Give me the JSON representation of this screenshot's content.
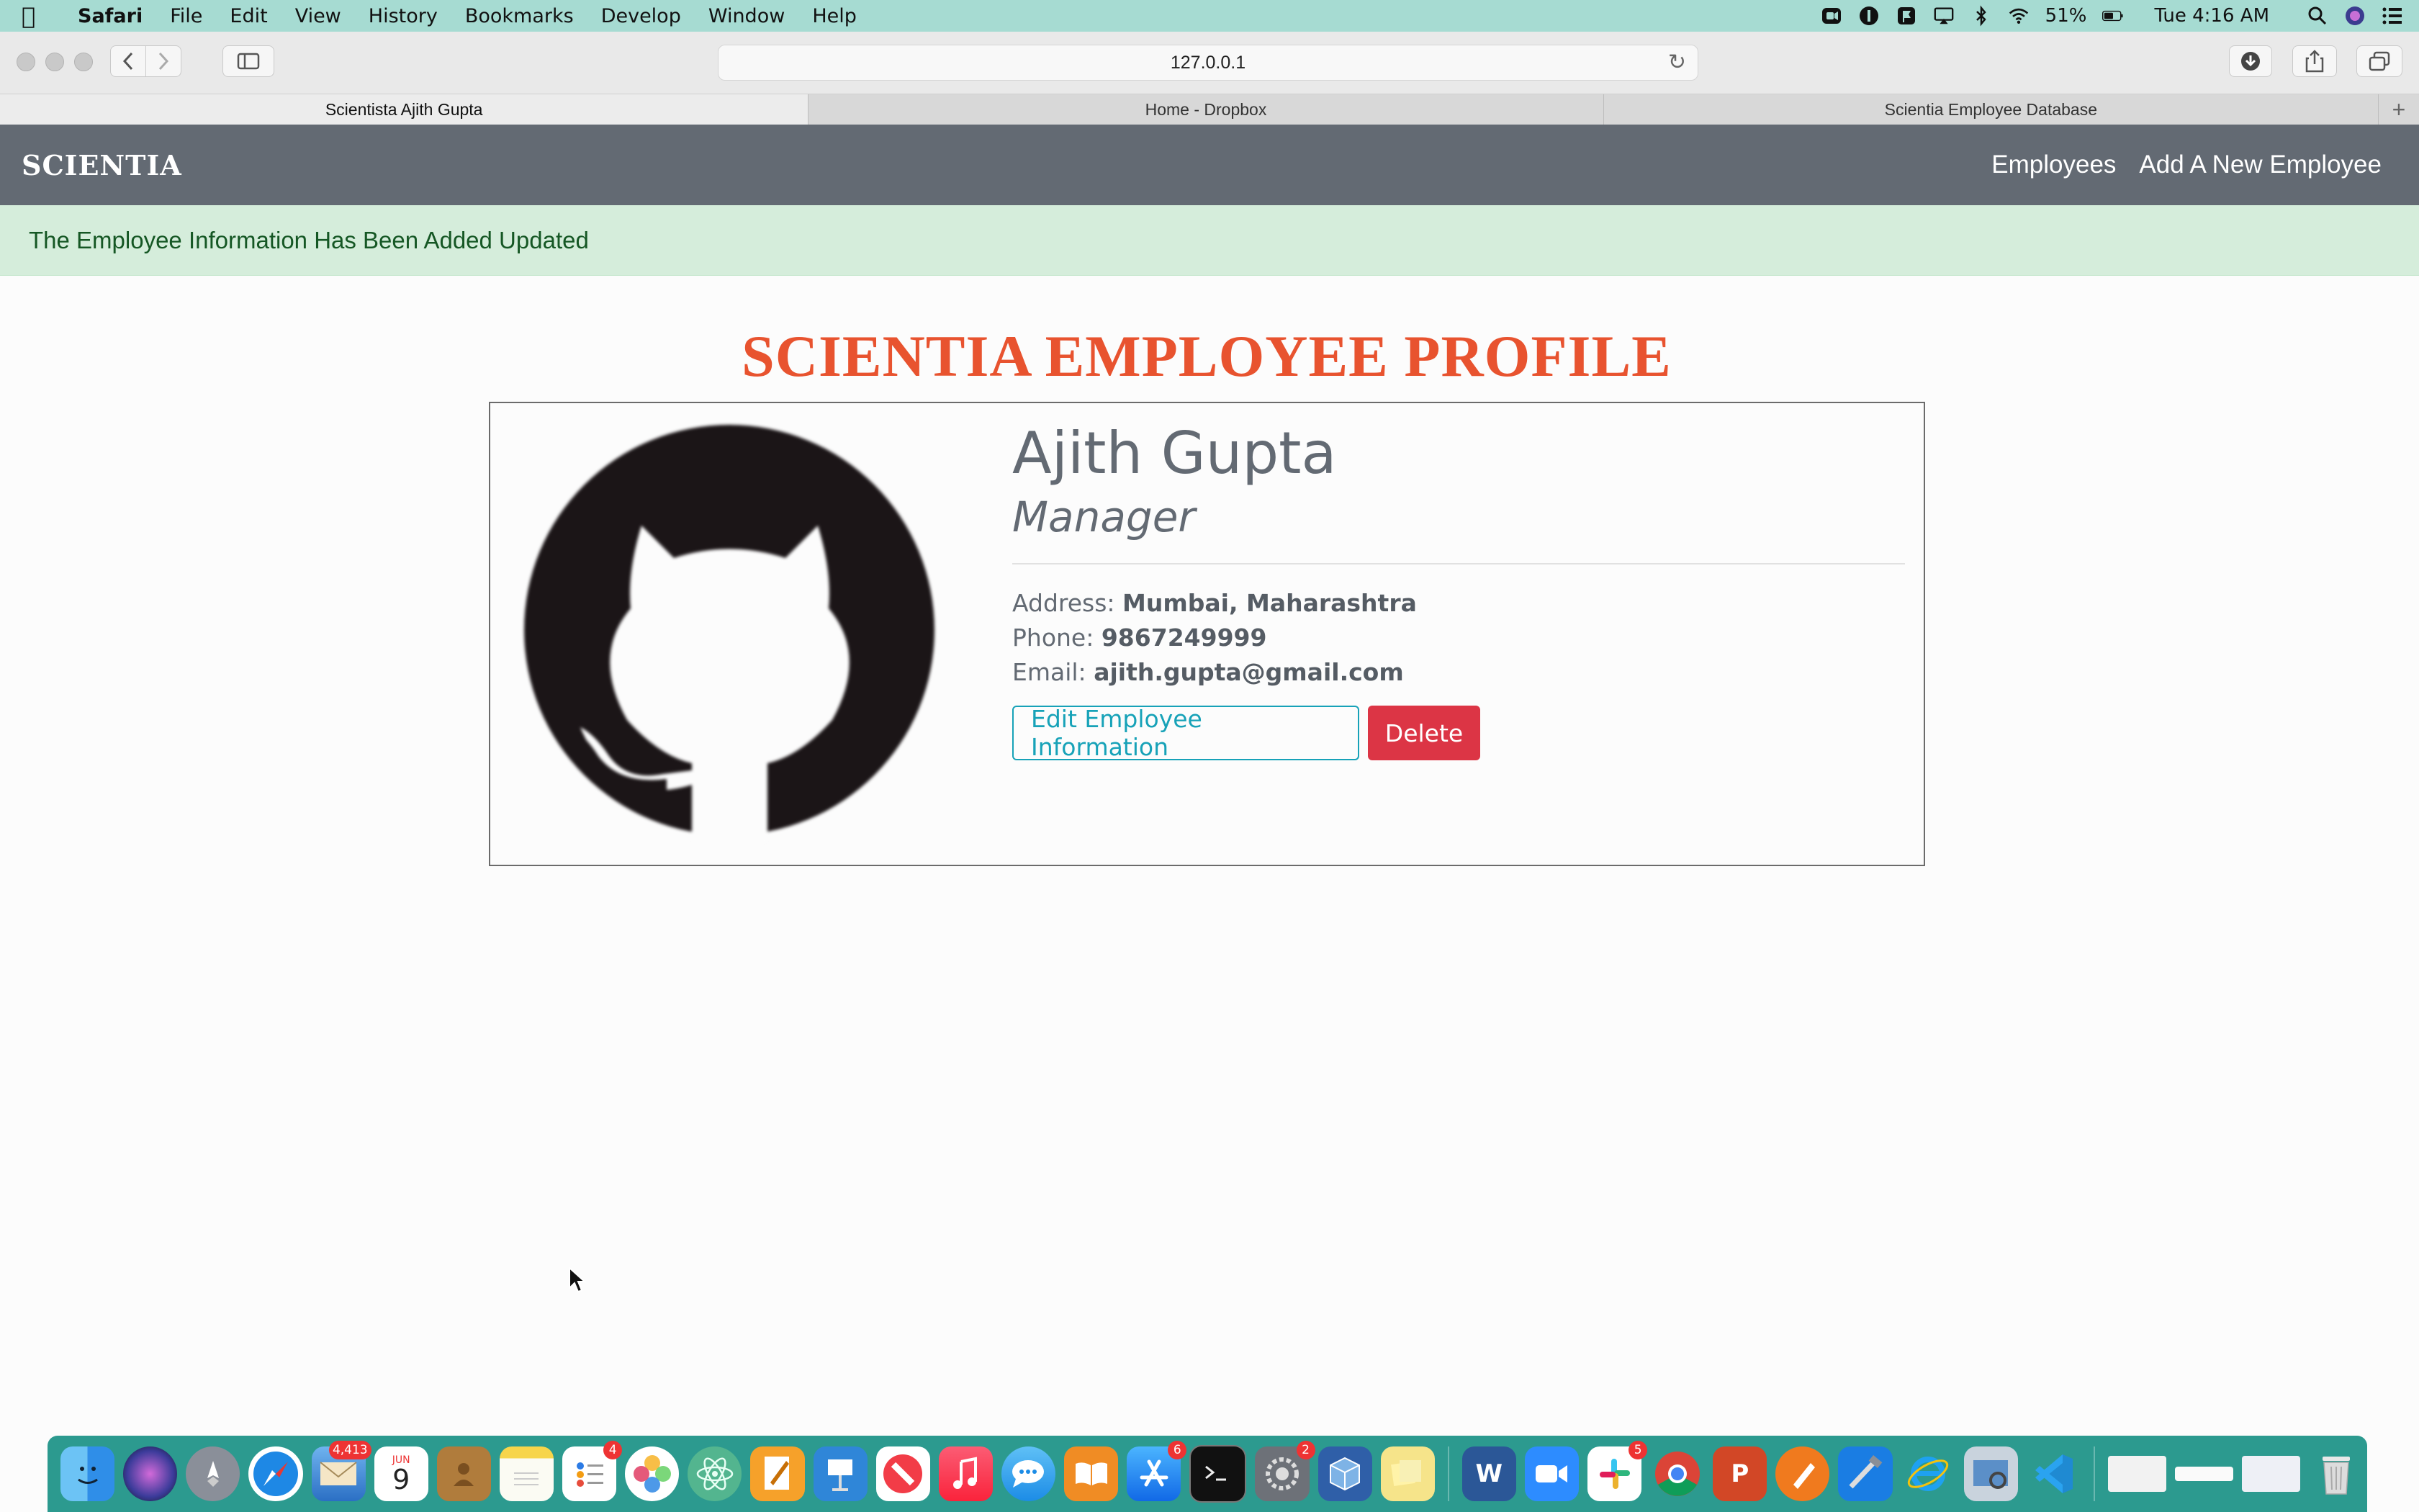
{
  "menubar": {
    "app_name": "Safari",
    "items": [
      "File",
      "Edit",
      "View",
      "History",
      "Bookmarks",
      "Develop",
      "Window",
      "Help"
    ],
    "battery": "51%",
    "clock": "Tue 4:16 AM"
  },
  "browser": {
    "url": "127.0.0.1",
    "tabs": [
      "Scientista Ajith Gupta",
      "Home - Dropbox",
      "Scientia Employee Database"
    ]
  },
  "site": {
    "brand": "SCIENTIA",
    "nav": [
      "Employees",
      "Add A New Employee"
    ],
    "alert": "The Employee Information Has Been Added Updated",
    "page_title": "SCIENTIA EMPLOYEE PROFILE"
  },
  "profile": {
    "name": "Ajith Gupta",
    "title": "Manager",
    "address_label": "Address:",
    "address": "Mumbai, Maharashtra",
    "phone_label": "Phone:",
    "phone": "9867249999",
    "email_label": "Email:",
    "email": "ajith.gupta@gmail.com",
    "edit_label": "Edit Employee Information",
    "delete_label": "Delete",
    "avatar_icon": "github-octocat-icon"
  },
  "dock": {
    "badges": {
      "mail": "4,413",
      "calendar_month": "JUN",
      "calendar_day": "9",
      "reminders": "4",
      "app_store": "6",
      "system_prefs": "2",
      "slack": "5"
    }
  },
  "colors": {
    "menubar": "#a6dbd2",
    "navbar": "#636a73",
    "alert_bg": "#d5eddb",
    "title": "#e8532f",
    "edit": "#17a2b8",
    "delete": "#dc3545",
    "dock": "#2c9a8f"
  }
}
